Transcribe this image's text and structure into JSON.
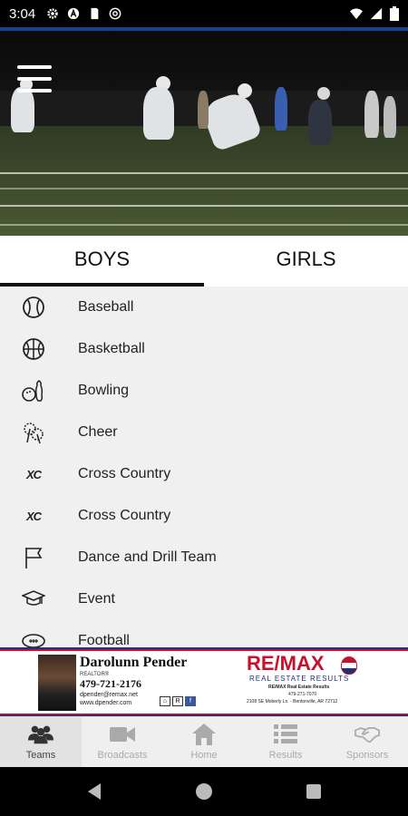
{
  "status_bar": {
    "time": "3:04",
    "left_icons": [
      "gear-icon",
      "a-circle-icon",
      "sd-card-icon",
      "at-sign-icon"
    ],
    "right_icons": [
      "wifi-icon",
      "signal-icon",
      "battery-icon"
    ]
  },
  "header": {
    "menu_icon": "hamburger-menu-icon"
  },
  "tabs": [
    {
      "label": "BOYS",
      "active": true
    },
    {
      "label": "GIRLS",
      "active": false
    }
  ],
  "sports": [
    {
      "label": "Baseball",
      "icon": "baseball-icon"
    },
    {
      "label": "Basketball",
      "icon": "basketball-icon"
    },
    {
      "label": "Bowling",
      "icon": "bowling-icon"
    },
    {
      "label": "Cheer",
      "icon": "pompom-icon"
    },
    {
      "label": "Cross Country",
      "icon": "xc-icon"
    },
    {
      "label": "Cross Country",
      "icon": "xc-icon"
    },
    {
      "label": "Dance and Drill Team",
      "icon": "flag-icon"
    },
    {
      "label": "Event",
      "icon": "graduation-cap-icon"
    },
    {
      "label": "Football",
      "icon": "football-icon"
    }
  ],
  "xc_text": "XC",
  "ad": {
    "agent_name": "Darolunn Pender",
    "agent_title": "REALTOR®",
    "phone": "479-721-2176",
    "email": "dpender@remax.net",
    "website": "www.dpender.com",
    "brand": "RE/MAX",
    "brand_sub": "REAL ESTATE RESULTS",
    "office_name": "RE/MAX Real Estate Results",
    "office_phone": "479-271-7070",
    "office_address": "2108 SE Moberly Ln. - Bentonville, AR 72712",
    "colors": {
      "red": "#c8102e",
      "blue": "#1f2f7a"
    }
  },
  "bottom_nav": [
    {
      "label": "Teams",
      "icon": "teams-icon",
      "active": true
    },
    {
      "label": "Broadcasts",
      "icon": "video-camera-icon",
      "active": false
    },
    {
      "label": "Home",
      "icon": "home-icon",
      "active": false
    },
    {
      "label": "Results",
      "icon": "list-icon",
      "active": false
    },
    {
      "label": "Sponsors",
      "icon": "handshake-icon",
      "active": false
    }
  ],
  "android_nav": [
    "back-icon",
    "home-circle-icon",
    "recents-icon"
  ]
}
